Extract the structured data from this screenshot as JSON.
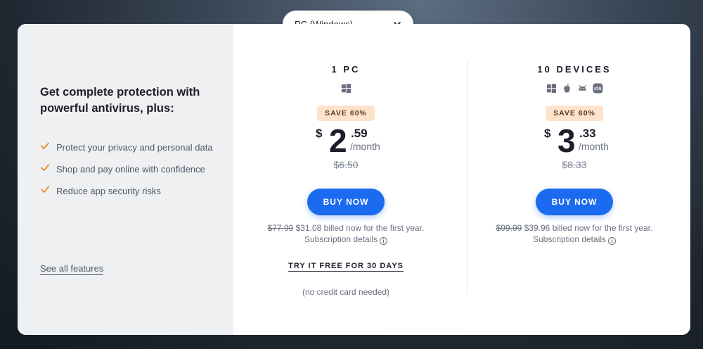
{
  "selector": {
    "value": "PC (Windows)"
  },
  "sidebar": {
    "heading": "Get complete protection with powerful antivirus, plus:",
    "features": [
      "Protect your privacy and personal data",
      "Shop and pay online with confidence",
      "Reduce app security risks"
    ],
    "see_all": "See all features"
  },
  "plans": [
    {
      "title": "1 PC",
      "os_icons": [
        "windows-icon"
      ],
      "badge": "SAVE 60%",
      "currency": "$",
      "price_major": "2",
      "price_cents": ".59",
      "per": "/month",
      "old_price": "$6.50",
      "buy_label": "BUY NOW",
      "billed_old": "$77.99",
      "billed_text": " $31.08 billed now for the first year.",
      "sub_details": "Subscription details",
      "try_free": "TRY IT FREE FOR 30 DAYS",
      "no_cc": "(no credit card needed)"
    },
    {
      "title": "10 DEVICES",
      "os_icons": [
        "windows-icon",
        "apple-icon",
        "android-icon",
        "ios-icon"
      ],
      "badge": "SAVE 60%",
      "currency": "$",
      "price_major": "3",
      "price_cents": ".33",
      "per": "/month",
      "old_price": "$8.33",
      "buy_label": "BUY NOW",
      "billed_old": "$99.99",
      "billed_text": " $39.96 billed now for the first year.",
      "sub_details": "Subscription details"
    }
  ],
  "info_glyph": "i",
  "ios_label": "iOS",
  "colors": {
    "accent": "#1a6bf0",
    "check": "#f08a24",
    "badge_bg": "#fde3cc",
    "panel_bg": "#eef0f2"
  }
}
